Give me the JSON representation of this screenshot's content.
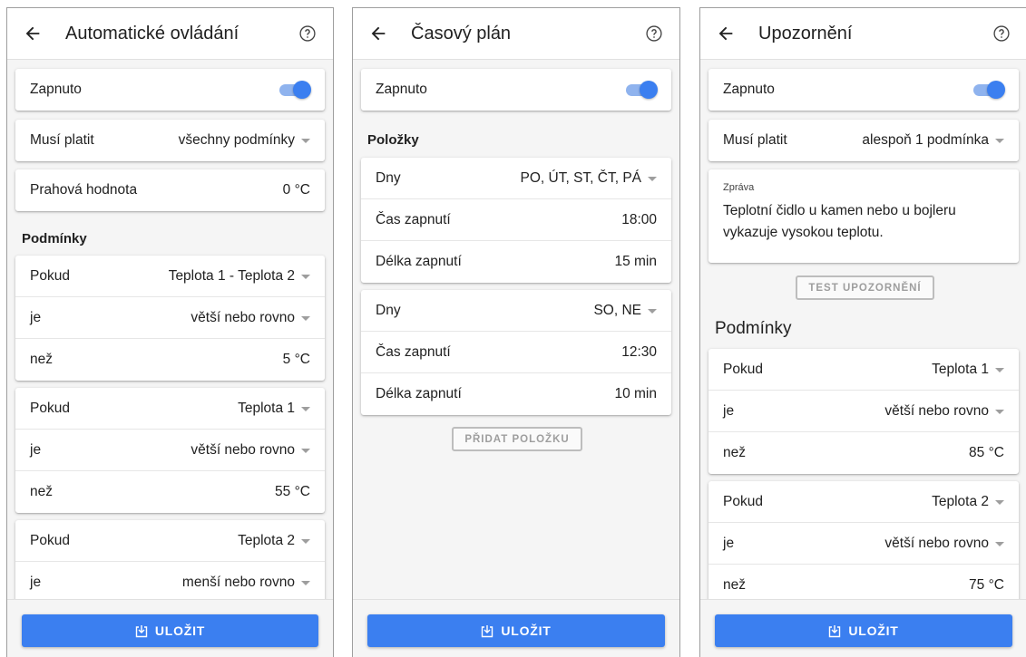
{
  "colors": {
    "accent": "#3b7ff0",
    "toggle_track": "#8fb3ee",
    "background": "#f5f5f5"
  },
  "icons": {
    "back": "arrow-left-icon",
    "help": "help-circle-icon",
    "save": "save-download-icon",
    "dropdown": "caret-down-icon"
  },
  "screen1": {
    "title": "Automatické ovládání",
    "enabled_label": "Zapnuto",
    "enabled": true,
    "must_label": "Musí platit",
    "must_value": "všechny podmínky",
    "threshold_label": "Prahová hodnota",
    "threshold_value": "0 °C",
    "conditions_header": "Podmínky",
    "conditions": [
      {
        "if_label": "Pokud",
        "if_value": "Teplota 1 - Teplota 2",
        "is_label": "je",
        "is_value": "větší nebo rovno",
        "than_label": "než",
        "than_value": "5 °C"
      },
      {
        "if_label": "Pokud",
        "if_value": "Teplota 1",
        "is_label": "je",
        "is_value": "větší nebo rovno",
        "than_label": "než",
        "than_value": "55 °C"
      },
      {
        "if_label": "Pokud",
        "if_value": "Teplota 2",
        "is_label": "je",
        "is_value": "menší nebo rovno"
      }
    ],
    "save_label": "ULOŽIT"
  },
  "screen2": {
    "title": "Časový plán",
    "enabled_label": "Zapnuto",
    "enabled": true,
    "items_header": "Položky",
    "items": [
      {
        "days_label": "Dny",
        "days_value": "PO, ÚT, ST, ČT, PÁ",
        "time_label": "Čas zapnutí",
        "time_value": "18:00",
        "duration_label": "Délka zapnutí",
        "duration_value": "15 min"
      },
      {
        "days_label": "Dny",
        "days_value": "SO, NE",
        "time_label": "Čas zapnutí",
        "time_value": "12:30",
        "duration_label": "Délka zapnutí",
        "duration_value": "10 min"
      }
    ],
    "add_label": "PŘIDAT POLOŽKU",
    "save_label": "ULOŽIT"
  },
  "screen3": {
    "title": "Upozornění",
    "enabled_label": "Zapnuto",
    "enabled": true,
    "must_label": "Musí platit",
    "must_value": "alespoň 1 podmínka",
    "message_label": "Zpráva",
    "message_text": "Teplotní čidlo u kamen nebo u bojleru vykazuje vysokou teplotu.",
    "test_label": "TEST UPOZORNĚNÍ",
    "conditions_header": "Podmínky",
    "conditions": [
      {
        "if_label": "Pokud",
        "if_value": "Teplota 1",
        "is_label": "je",
        "is_value": "větší nebo rovno",
        "than_label": "než",
        "than_value": "85 °C"
      },
      {
        "if_label": "Pokud",
        "if_value": "Teplota 2",
        "is_label": "je",
        "is_value": "větší nebo rovno",
        "than_label": "než",
        "than_value": "75 °C"
      }
    ],
    "save_label": "ULOŽIT"
  }
}
